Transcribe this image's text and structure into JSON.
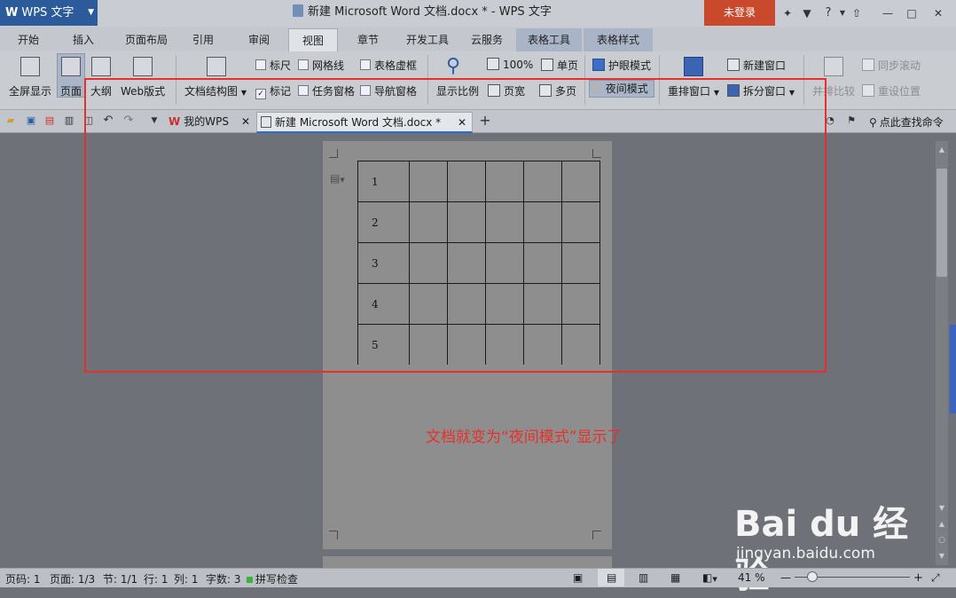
{
  "titlebar": {
    "app_name": "WPS 文字",
    "app_logo": "W",
    "window_title": "新建 Microsoft Word 文档.docx * - WPS 文字",
    "login_label": "未登录",
    "help_label": "?"
  },
  "tabs": [
    "开始",
    "插入",
    "页面布局",
    "引用",
    "审阅",
    "视图",
    "章节",
    "开发工具",
    "云服务",
    "表格工具",
    "表格样式"
  ],
  "ribbon": {
    "fullscreen": "全屏显示",
    "page": "页面",
    "outline": "大纲",
    "web": "Web版式",
    "doc_structure": "文档结构图",
    "ruler": "标尺",
    "gridlines": "网格线",
    "table_gridlines": "表格虚框",
    "mark": "标记",
    "task_pane": "任务窗格",
    "nav_pane": "导航窗格",
    "zoom": "显示比例",
    "zoom_100": "100%",
    "single_page": "单页",
    "page_width": "页宽",
    "multi_page": "多页",
    "eye_mode": "护眼模式",
    "night_mode": "夜间模式",
    "rearrange": "重排窗口",
    "new_window": "新建窗口",
    "split_window": "拆分窗口",
    "side_by_side": "并排比较",
    "sync_scroll": "同步滚动",
    "reset_position": "重设位置"
  },
  "quickbar": {
    "doc_tabs": [
      "我的WPS",
      "新建 Microsoft Word 文档.docx *"
    ],
    "search_label": "点此查找命令",
    "wps_logo": "W"
  },
  "document": {
    "rows": [
      "1",
      "2",
      "3",
      "4",
      "5"
    ],
    "columns": 6
  },
  "annotation": "文档就变为“夜间模式”显示了",
  "statusbar": {
    "page_num": "页码: 1",
    "pages": "页面: 1/3",
    "section": "节: 1/1",
    "row": "行: 1",
    "col": "列: 1",
    "word_count": "字数: 3",
    "spell_check": "拼写检查",
    "zoom_value": "41 %"
  },
  "watermark": {
    "brand": "Bai du 经验",
    "url": "jingyan.baidu.com"
  },
  "colors": {
    "annotation_red": "#e8302a",
    "login_red": "#c9492c",
    "app_blue": "#2b5b9b"
  }
}
